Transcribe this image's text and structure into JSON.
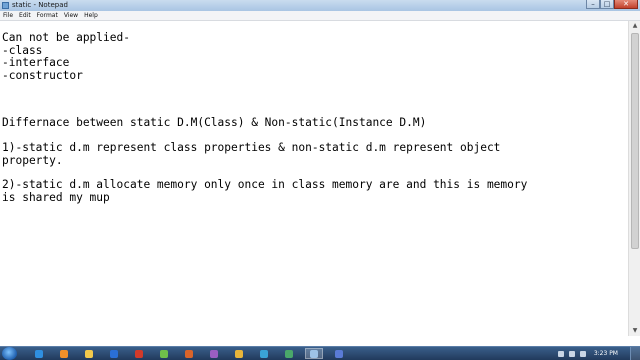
{
  "window": {
    "title": "static - Notepad",
    "controls": {
      "minimize": "–",
      "maximize": "□",
      "close": "✕"
    }
  },
  "menu": [
    "File",
    "Edit",
    "Format",
    "View",
    "Help"
  ],
  "editor": {
    "blocks": [
      [
        "Can not be applied-",
        "-class",
        "-interface",
        "-constructor"
      ],
      [
        "Differnace between static D.M(Class) & Non-static(Instance D.M)"
      ],
      [
        "1)-static d.m represent class properties & non-static d.m represent object",
        "property."
      ],
      [
        "2)-static d.m allocate memory only once in class memory are and this is memory",
        "is shared my mup"
      ]
    ]
  },
  "scrollbar": {
    "up": "▲",
    "down": "▼"
  },
  "taskbar": {
    "apps": [
      {
        "icon": "ie-icon",
        "color": "#2f8fe0"
      },
      {
        "icon": "media-player-icon",
        "color": "#f0902a"
      },
      {
        "icon": "explorer-icon",
        "color": "#f2c94c"
      },
      {
        "icon": "outlook-icon",
        "color": "#2a6fd6"
      },
      {
        "icon": "app-icon",
        "color": "#d23a2a"
      },
      {
        "icon": "app-icon",
        "color": "#6fbf4a"
      },
      {
        "icon": "powerpoint-icon",
        "color": "#d9642a"
      },
      {
        "icon": "app-icon",
        "color": "#9a5ec2"
      },
      {
        "icon": "chrome-icon",
        "color": "#e8b53a"
      },
      {
        "icon": "app-icon",
        "color": "#3aa4d6"
      },
      {
        "icon": "app-icon",
        "color": "#4aa86a"
      },
      {
        "icon": "notepad-icon",
        "color": "#9ec3e6",
        "active": true
      },
      {
        "icon": "app-icon",
        "color": "#5a7bd6"
      }
    ],
    "clock": "3:23 PM"
  }
}
